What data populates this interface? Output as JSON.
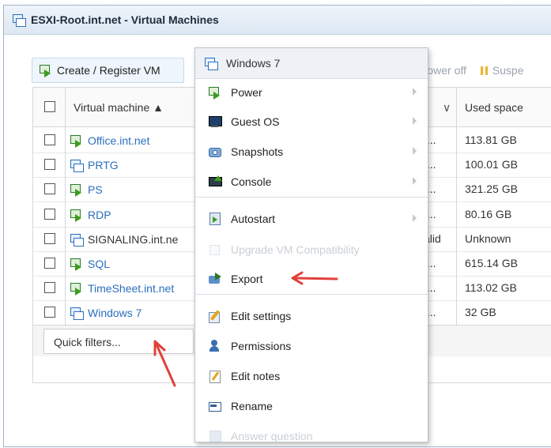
{
  "window": {
    "title": "ESXI-Root.int.net - Virtual Machines",
    "icon": "vm-group-icon"
  },
  "toolbar": {
    "create_label": "Create / Register VM",
    "power_off_label": "Power off",
    "suspend_label": "Suspe"
  },
  "grid": {
    "columns": {
      "vm": "Virtual machine ▲",
      "state_chevron": "∨",
      "used": "Used space"
    },
    "rows": [
      {
        "name": "Office.int.net",
        "state": "r...",
        "used": "113.81 GB",
        "icon": "vm-on-icon"
      },
      {
        "name": "PRTG",
        "state": "r...",
        "used": "100.01 GB",
        "icon": "vm-off-icon"
      },
      {
        "name": "PS",
        "state": "r...",
        "used": "321.25 GB",
        "icon": "vm-on-icon"
      },
      {
        "name": "RDP",
        "state": "r...",
        "used": "80.16 GB",
        "icon": "vm-on-icon"
      },
      {
        "name": "SIGNALING.int.ne",
        "state": "alid",
        "used": "Unknown",
        "icon": "vm-off-icon"
      },
      {
        "name": "SQL",
        "state": "r...",
        "used": "615.14 GB",
        "icon": "vm-on-icon"
      },
      {
        "name": "TimeSheet.int.net",
        "state": "r...",
        "used": "113.02 GB",
        "icon": "vm-on-icon"
      },
      {
        "name": "Windows 7",
        "state": "r...",
        "used": "32 GB",
        "icon": "vm-off-icon"
      }
    ],
    "quick_filters": "Quick filters..."
  },
  "menu": {
    "title": "Windows 7",
    "items": [
      {
        "label": "Power",
        "icon": "power-icon",
        "submenu": true,
        "disabled": false
      },
      {
        "label": "Guest OS",
        "icon": "guest-os-icon",
        "submenu": true,
        "disabled": false
      },
      {
        "label": "Snapshots",
        "icon": "snapshots-icon",
        "submenu": true,
        "disabled": false
      },
      {
        "label": "Console",
        "icon": "console-icon",
        "submenu": true,
        "disabled": false
      },
      {
        "label": "Autostart",
        "icon": "autostart-icon",
        "submenu": true,
        "disabled": false
      },
      {
        "label": "Upgrade VM Compatibility",
        "icon": "upgrade-icon",
        "submenu": false,
        "disabled": true
      },
      {
        "label": "Export",
        "icon": "export-icon",
        "submenu": false,
        "disabled": false
      },
      {
        "label": "Edit settings",
        "icon": "edit-settings-icon",
        "submenu": false,
        "disabled": false
      },
      {
        "label": "Permissions",
        "icon": "permissions-icon",
        "submenu": false,
        "disabled": false
      },
      {
        "label": "Edit notes",
        "icon": "edit-notes-icon",
        "submenu": false,
        "disabled": false
      },
      {
        "label": "Rename",
        "icon": "rename-icon",
        "submenu": false,
        "disabled": false
      },
      {
        "label": "Answer question",
        "icon": "answer-question-icon",
        "submenu": false,
        "disabled": true
      }
    ]
  },
  "colors": {
    "link": "#2a6fbe",
    "annotation": "#e0413a",
    "running": "#3c9c1c"
  }
}
